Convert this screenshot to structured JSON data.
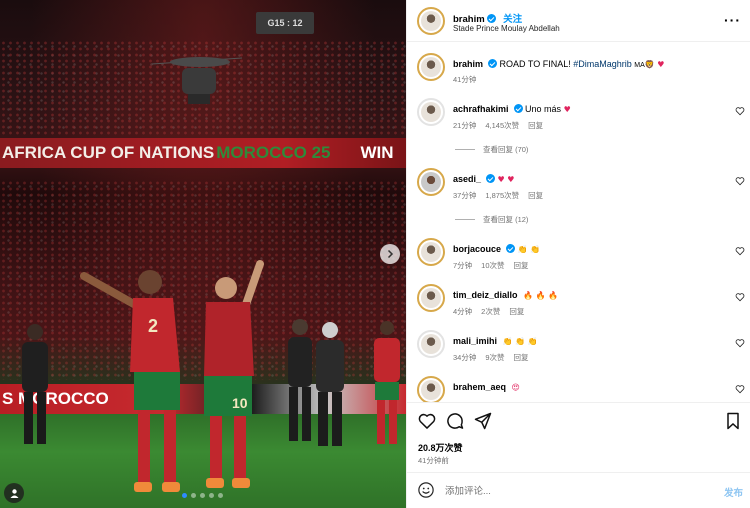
{
  "photo": {
    "banner_text": "AFRICA CUP OF NATIONS",
    "banner_green": "MOROCCO 25",
    "banner_tail": "WIN",
    "scoreboard": "G15 : 12",
    "ad_text": "S MOROCCO",
    "player1_number": "2",
    "player2_number": "10",
    "carousel_dots": 5,
    "active_dot": 0
  },
  "header": {
    "username": "brahim",
    "follow_label": "关注",
    "location": "Stade Prince Moulay Abdellah",
    "more_label": "···"
  },
  "caption": {
    "username": "brahim",
    "text": "ROAD TO FINAL!",
    "hashtag": "#DimaMaghrib",
    "tail": "MA",
    "time": "41分钟"
  },
  "comments": [
    {
      "username": "achrafhakimi",
      "verified": true,
      "text": "Uno más",
      "emoji": "♥",
      "time": "21分钟",
      "likes": "4,145次赞",
      "reply_label": "回复",
      "view_replies": "查看回复 (70)"
    },
    {
      "username": "asedi_",
      "verified": true,
      "text": "",
      "emoji": "♥ ♥",
      "time": "37分钟",
      "likes": "1,875次赞",
      "reply_label": "回复",
      "view_replies": "查看回复 (12)"
    },
    {
      "username": "borjacouce",
      "verified": true,
      "text": "",
      "emoji": "👏 👏",
      "time": "7分钟",
      "likes": "10次赞",
      "reply_label": "回复"
    },
    {
      "username": "tim_deiz_diallo",
      "verified": false,
      "text": "",
      "emoji": "🔥 🔥 🔥",
      "time": "4分钟",
      "likes": "2次赞",
      "reply_label": "回复"
    },
    {
      "username": "mali_imihi",
      "verified": false,
      "text": "",
      "emoji": "👏 👏 👏",
      "time": "34分钟",
      "likes": "9次赞",
      "reply_label": "回复"
    },
    {
      "username": "brahem_aeq",
      "verified": false,
      "text": "",
      "emoji": "😍",
      "time": "",
      "likes": "",
      "reply_label": ""
    }
  ],
  "actions": {
    "likes": "20.8万次赞",
    "posted": "41分钟前"
  },
  "add_comment": {
    "placeholder": "添加评论...",
    "post_label": "发布"
  },
  "colors": {
    "accent": "#0095f6",
    "story_ring": "#d7a84a",
    "heart": "#e0245e"
  }
}
